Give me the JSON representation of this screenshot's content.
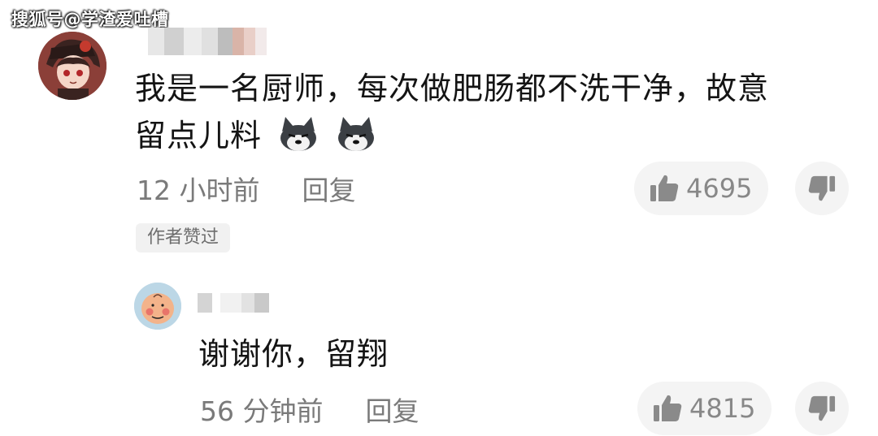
{
  "watermark": "搜狐号@学渣爱吐槽",
  "comments": [
    {
      "text_line1": "我是一名厨师，每次做肥肠都不洗干净，故意",
      "text_line2": "留点儿料",
      "time": "12 小时前",
      "reply": "回复",
      "likes": "4695",
      "author_badge": "作者赞过",
      "emoji": "husky-dog-emoji"
    },
    {
      "text": "谢谢你，留翔",
      "time": "56 分钟前",
      "reply": "回复",
      "likes": "4815"
    }
  ],
  "colors": {
    "text": "#141414",
    "meta": "#7a7a7a",
    "pill": "#f4f4f4",
    "icon": "#8a8a8a"
  }
}
